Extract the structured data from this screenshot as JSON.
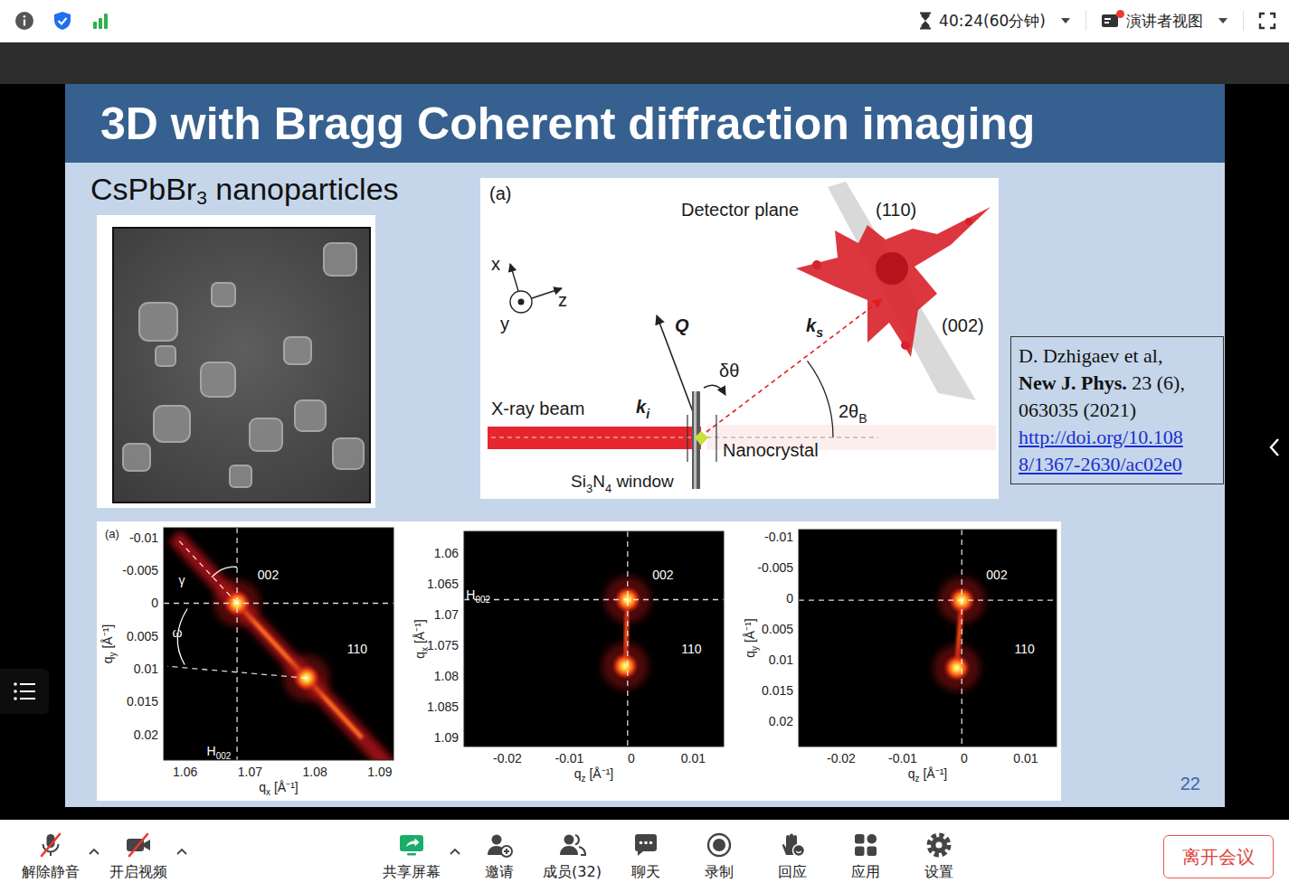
{
  "topbar": {
    "timer": "40:24(60分钟)",
    "view_menu": "演讲者视图",
    "view_menu_badge": true
  },
  "slide": {
    "title": "3D with Bragg Coherent diffraction imaging",
    "subtitle": [
      {
        "text": "CsPbBr",
        "sub": false
      },
      {
        "text": "3",
        "sub": true
      },
      {
        "text": " nanoparticles",
        "sub": false
      }
    ],
    "diagram": {
      "panel": "(a)",
      "detector": "Detector plane",
      "reflections": [
        "(110)",
        "(002)"
      ],
      "axes": [
        "x",
        "y",
        "z"
      ],
      "scattering_vector": "Q",
      "incident": [
        {
          "text": "k",
          "sub": false
        },
        {
          "text": "i",
          "sub": true
        }
      ],
      "scattered": [
        {
          "text": "k",
          "sub": false
        },
        {
          "text": "s",
          "sub": true
        }
      ],
      "rocking": "δθ",
      "angle": [
        {
          "text": "2θ",
          "sub": false
        },
        {
          "text": "B",
          "sub": true
        }
      ],
      "beam": "X-ray beam",
      "sample": "Nanocrystal",
      "window": [
        {
          "text": "Si",
          "sub": false
        },
        {
          "text": "3",
          "sub": true
        },
        {
          "text": "N",
          "sub": false
        },
        {
          "text": "4",
          "sub": true
        },
        {
          "text": " window",
          "sub": false
        }
      ]
    },
    "reference": {
      "lines": [
        [
          {
            "text": "D. Dzhigaev et al,",
            "bold": false
          }
        ],
        [
          {
            "text": "New J. Phys.",
            "bold": true
          },
          {
            "text": " 23 (6),",
            "bold": false
          }
        ],
        [
          {
            "text": "063035 (2021)",
            "bold": false
          }
        ]
      ],
      "link": [
        "http://doi.org/10.108",
        "8/1367-2630/ac02e0"
      ]
    },
    "plots": [
      {
        "panel": "(a)",
        "kind": "diagonal",
        "x_axis": {
          "label": [
            {
              "text": "q",
              "sub": false
            },
            {
              "text": "x",
              "sub": true
            },
            {
              "text": " [Å⁻¹]",
              "sub": false
            }
          ],
          "ticks": [
            "1.06",
            "1.07",
            "1.08",
            "1.09"
          ],
          "range": [
            1.0567,
            1.0921
          ]
        },
        "y_axis": {
          "label": [
            {
              "text": "q",
              "sub": false
            },
            {
              "text": "y",
              "sub": true
            },
            {
              "text": " [Å⁻¹]",
              "sub": false
            }
          ],
          "ticks": [
            "-0.01",
            "-0.005",
            "0",
            "0.005",
            "0.01",
            "0.015",
            "0.02"
          ],
          "range": [
            -0.0115,
            0.0239
          ]
        },
        "peaks": [
          {
            "label": "002",
            "x": 1.068,
            "y": 0,
            "label_x": 1.0728,
            "label_y": -0.0044
          },
          {
            "label": "110",
            "x": 1.0787,
            "y": 0.0114,
            "label_x": 1.0865,
            "label_y": 0.0069
          }
        ],
        "annotations": [
          {
            "parts": [
              {
                "text": "γ",
                "sub": false
              }
            ],
            "x": 1.0595,
            "y": -0.0035
          },
          {
            "parts": [
              {
                "text": "ω",
                "sub": false
              }
            ],
            "x": 1.0588,
            "y": 0.0045
          },
          {
            "parts": [
              {
                "text": "H",
                "sub": false
              },
              {
                "text": "002",
                "sub": true
              }
            ],
            "x": 1.0652,
            "y": 0.0225
          }
        ]
      },
      {
        "panel": "",
        "kind": "cross",
        "x_axis": {
          "label": [
            {
              "text": "q",
              "sub": false
            },
            {
              "text": "z",
              "sub": true
            },
            {
              "text": " [Å⁻¹]",
              "sub": false
            }
          ],
          "ticks": [
            "-0.02",
            "-0.01",
            "0",
            "0.01"
          ],
          "range": [
            -0.027,
            0.0149
          ]
        },
        "y_axis": {
          "label": [
            {
              "text": "q",
              "sub": false
            },
            {
              "text": "x",
              "sub": true
            },
            {
              "text": " [Å⁻¹]",
              "sub": false
            }
          ],
          "ticks": [
            "1.06",
            "1.065",
            "1.07",
            "1.075",
            "1.08",
            "1.085",
            "1.09"
          ],
          "range": [
            1.0565,
            1.0915
          ]
        },
        "peaks": [
          {
            "label": "002",
            "x": -0.0006,
            "y": 1.0676,
            "label_x": 0.0051,
            "label_y": 1.0635
          },
          {
            "label": "110",
            "x": -0.001,
            "y": 1.0784,
            "label_x": 0.0097,
            "label_y": 1.0756
          }
        ],
        "annotations": [
          {
            "parts": [
              {
                "text": "H",
                "sub": false
              },
              {
                "text": "002",
                "sub": true
              }
            ],
            "x": -0.0247,
            "y": 1.0668
          }
        ]
      },
      {
        "panel": "",
        "kind": "cross",
        "x_axis": {
          "label": [
            {
              "text": "q",
              "sub": false
            },
            {
              "text": "z",
              "sub": true
            },
            {
              "text": " [Å⁻¹]",
              "sub": false
            }
          ],
          "ticks": [
            "-0.02",
            "-0.01",
            "0",
            "0.01"
          ],
          "range": [
            -0.0269,
            0.015
          ]
        },
        "y_axis": {
          "label": [
            {
              "text": "q",
              "sub": false
            },
            {
              "text": "y",
              "sub": true
            },
            {
              "text": " [Å⁻¹]",
              "sub": false
            }
          ],
          "ticks": [
            "-0.01",
            "-0.005",
            "0",
            "0.005",
            "0.01",
            "0.015",
            "0.02"
          ],
          "range": [
            -0.0112,
            0.0241
          ]
        },
        "peaks": [
          {
            "label": "002",
            "x": -0.0004,
            "y": 0.0003,
            "label_x": 0.0053,
            "label_y": -0.0038
          },
          {
            "label": "110",
            "x": -0.0012,
            "y": 0.0113,
            "label_x": 0.0098,
            "label_y": 0.0082
          }
        ],
        "annotations": []
      }
    ],
    "page_number": "22"
  },
  "toolbar": {
    "left": [
      {
        "label": "解除静音",
        "kind": "mic",
        "off": true,
        "has_menu": true
      },
      {
        "label": "开启视频",
        "kind": "camera",
        "off": true,
        "has_menu": true
      }
    ],
    "center": [
      {
        "label": "共享屏幕",
        "kind": "share",
        "off": false,
        "has_menu": true
      },
      {
        "label": "邀请",
        "kind": "invite",
        "off": false,
        "has_menu": false
      },
      {
        "label": "成员(32)",
        "kind": "members",
        "off": false,
        "has_menu": false
      },
      {
        "label": "聊天",
        "kind": "chat",
        "off": false,
        "has_menu": false
      },
      {
        "label": "录制",
        "kind": "record",
        "off": false,
        "has_menu": false
      },
      {
        "label": "回应",
        "kind": "react",
        "off": false,
        "has_menu": false
      },
      {
        "label": "应用",
        "kind": "apps",
        "off": false,
        "has_menu": false
      },
      {
        "label": "设置",
        "kind": "settings",
        "off": false,
        "has_menu": false
      }
    ],
    "leave": "离开会议"
  }
}
